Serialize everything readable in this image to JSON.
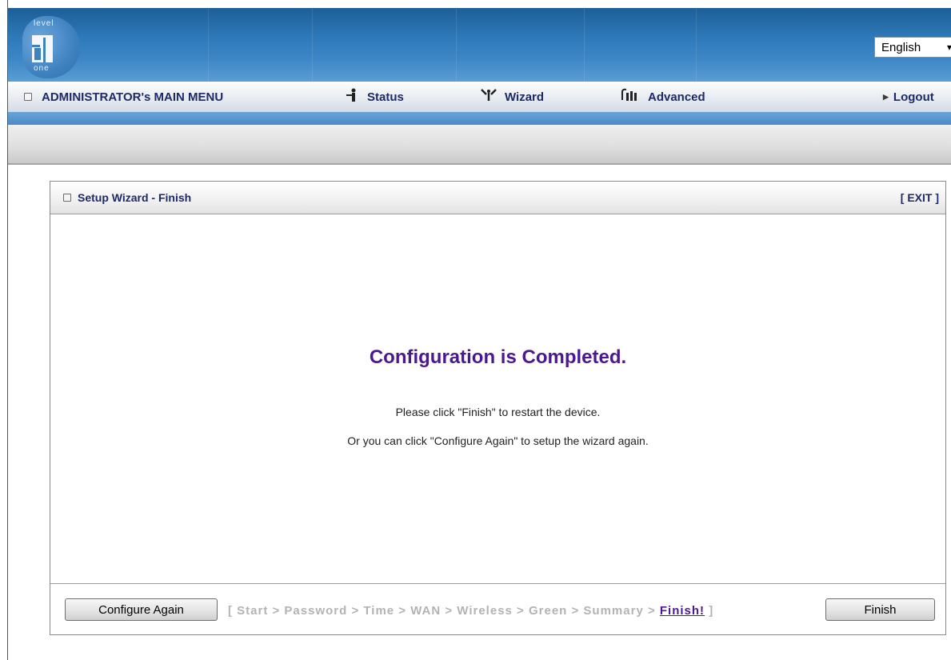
{
  "header": {
    "logo": {
      "top_text": "level",
      "bottom_text": "one"
    },
    "language": {
      "selected": "English"
    }
  },
  "nav": {
    "main_menu_label": "ADMINISTRATOR's MAIN MENU",
    "items": [
      {
        "label": "Status",
        "icon": "status-icon"
      },
      {
        "label": "Wizard",
        "icon": "wizard-icon"
      },
      {
        "label": "Advanced",
        "icon": "advanced-icon"
      }
    ],
    "logout_label": "Logout"
  },
  "panel": {
    "title": "Setup Wizard - Finish",
    "exit_label": "[ EXIT ]",
    "heading": "Configuration is Completed.",
    "message_1": "Please click \"Finish\" to restart the device.",
    "message_2": "Or you can click \"Configure Again\" to setup the wizard again."
  },
  "footer": {
    "configure_again_label": "Configure Again",
    "finish_label": "Finish",
    "steps_prefix": "[ Start > Password > Time > WAN > Wireless > Green > Summary > ",
    "steps_current": "Finish!",
    "steps_suffix": " ]"
  },
  "colors": {
    "accent_purple": "#4b1890",
    "nav_text": "#1c2a66",
    "banner_blue": "#2e79ba",
    "inactive_step": "#b3b3b3"
  }
}
